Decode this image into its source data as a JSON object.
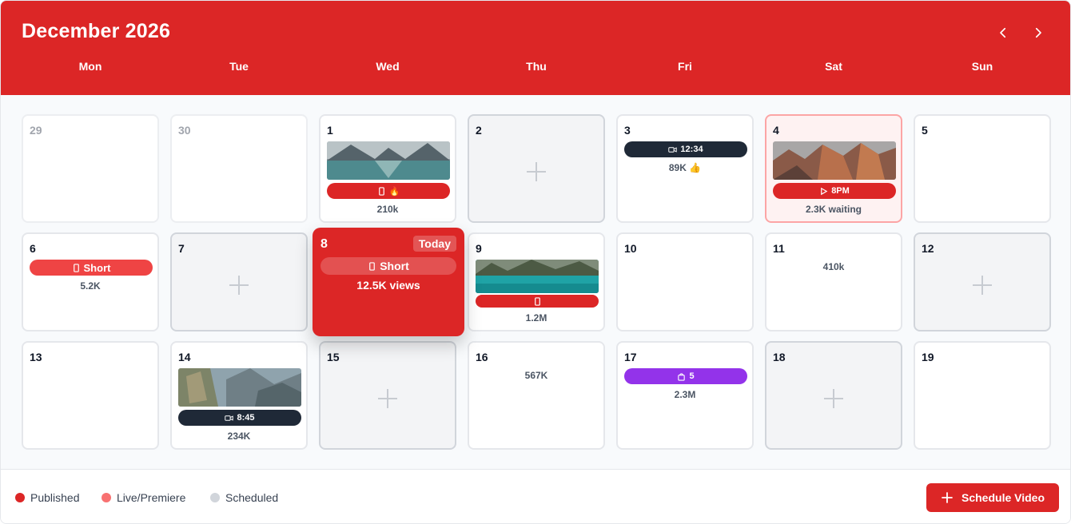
{
  "header": {
    "title": "December 2026",
    "weekdays": [
      "Mon",
      "Tue",
      "Wed",
      "Thu",
      "Fri",
      "Sat",
      "Sun"
    ]
  },
  "colors": {
    "brand": "#dc2626",
    "live": "#f87171",
    "scheduled": "#d1d5db",
    "duration_pill": "#1f2937",
    "purple_pill": "#9333ea"
  },
  "days": {
    "d29": {
      "day": "29"
    },
    "d30": {
      "day": "30"
    },
    "d1": {
      "day": "1",
      "pill": "🔥",
      "stat": "210k"
    },
    "d2": {
      "day": "2"
    },
    "d3": {
      "day": "3",
      "pill": "12:34",
      "stat": "89K 👍"
    },
    "d4": {
      "day": "4",
      "pill": "8PM",
      "stat": "2.3K waiting"
    },
    "d5": {
      "day": "5"
    },
    "d6": {
      "day": "6",
      "pill": "Short",
      "stat": "5.2K"
    },
    "d7": {
      "day": "7"
    },
    "d8": {
      "day": "8",
      "badge": "Today",
      "pill": "Short",
      "stat": "12.5K views"
    },
    "d9": {
      "day": "9",
      "stat": "1.2M"
    },
    "d10": {
      "day": "10"
    },
    "d11": {
      "day": "11",
      "stat": "410k"
    },
    "d12": {
      "day": "12"
    },
    "d13": {
      "day": "13"
    },
    "d14": {
      "day": "14",
      "pill": "8:45",
      "stat": "234K"
    },
    "d15": {
      "day": "15"
    },
    "d16": {
      "day": "16",
      "stat": "567K"
    },
    "d17": {
      "day": "17",
      "pill": "5",
      "stat": "2.3M"
    },
    "d18": {
      "day": "18"
    },
    "d19": {
      "day": "19"
    }
  },
  "legend": {
    "published": "Published",
    "live": "Live/Premiere",
    "scheduled": "Scheduled"
  },
  "actions": {
    "schedule": "Schedule Video"
  }
}
